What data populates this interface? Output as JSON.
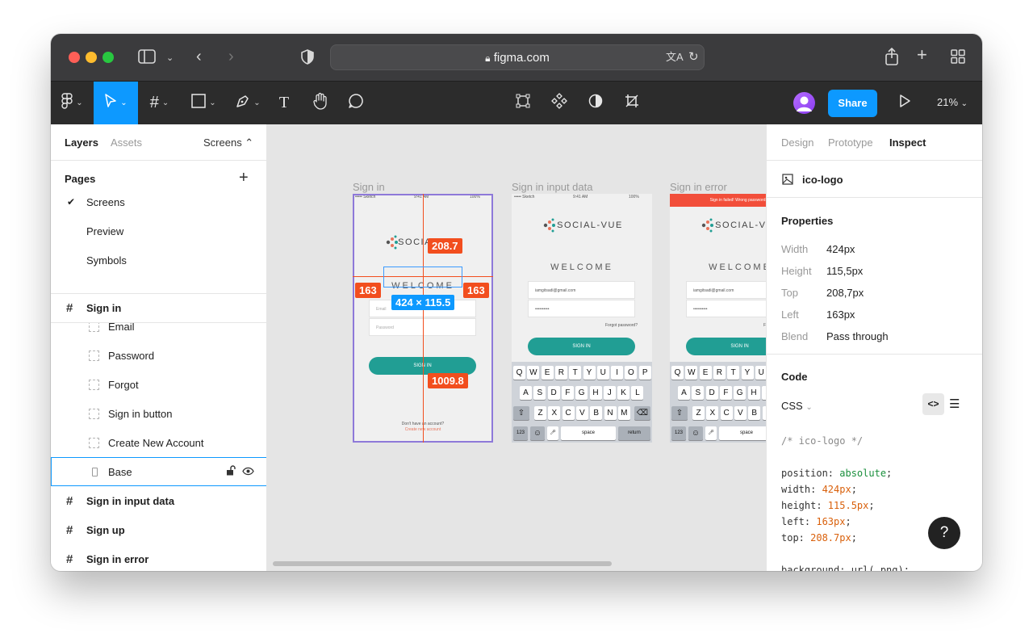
{
  "browser": {
    "url": "figma.com"
  },
  "toolbar": {
    "share_label": "Share",
    "zoom": "21%"
  },
  "left_panel": {
    "tabs": [
      "Layers",
      "Assets"
    ],
    "page_dropdown": "Screens ⌃",
    "pages_title": "Pages",
    "pages": [
      "Screens",
      "Preview",
      "Symbols"
    ],
    "active_frame": "Sign in",
    "layers": [
      "Email",
      "Password",
      "Forgot",
      "Sign in button",
      "Create New Account",
      "Base"
    ],
    "frames": [
      "Sign in input data",
      "Sign up",
      "Sign in error"
    ]
  },
  "canvas": {
    "frame_labels": [
      "Sign in",
      "Sign in input data",
      "Sign in error"
    ],
    "measures": {
      "top": "208.7",
      "left": "163",
      "right": "163",
      "size": "424 × 115.5",
      "bottom": "1009.8"
    },
    "phone": {
      "status_left": "••••• Sketch",
      "status_time": "9:41 AM",
      "status_right": "100%",
      "logo": "SOCIAL-VUE",
      "welcome": "WELCOME",
      "email_placeholder": "Email",
      "password_placeholder": "Password",
      "email_value": "iamgitsadi@gmail.com",
      "password_value": "••••••••••",
      "forgot": "Forgot password?",
      "sign_in": "SIGN IN",
      "no_account": "Don't have an account?",
      "create": "Create new account",
      "error_banner": "Sign in failed! Wrong password or",
      "kb_row1": [
        "Q",
        "W",
        "E",
        "R",
        "T",
        "Y",
        "U",
        "I",
        "O",
        "P"
      ],
      "kb_row2": [
        "A",
        "S",
        "D",
        "F",
        "G",
        "H",
        "J",
        "K",
        "L"
      ],
      "kb_row3": [
        "Z",
        "X",
        "C",
        "V",
        "B",
        "N",
        "M"
      ],
      "kb_123": "123",
      "kb_space": "space",
      "kb_return": "return"
    }
  },
  "right_panel": {
    "tabs": [
      "Design",
      "Prototype",
      "Inspect"
    ],
    "layer_name": "ico-logo",
    "properties_title": "Properties",
    "properties": [
      {
        "label": "Width",
        "value": "424px"
      },
      {
        "label": "Height",
        "value": "115,5px"
      },
      {
        "label": "Top",
        "value": "208,7px"
      },
      {
        "label": "Left",
        "value": "163px"
      },
      {
        "label": "Blend",
        "value": "Pass through"
      }
    ],
    "code_title": "Code",
    "code_lang": "CSS",
    "code": {
      "comment": "/* ico-logo */",
      "position_key": "position: ",
      "position_val": "absolute",
      "width_key": "width: ",
      "width_val": "424px",
      "height_key": "height: ",
      "height_val": "115.5px",
      "left_key": "left: ",
      "left_val": "163px",
      "top_key": "top: ",
      "top_val": "208.7px",
      "background_line": "background: url(.png);"
    }
  },
  "help_label": "?"
}
